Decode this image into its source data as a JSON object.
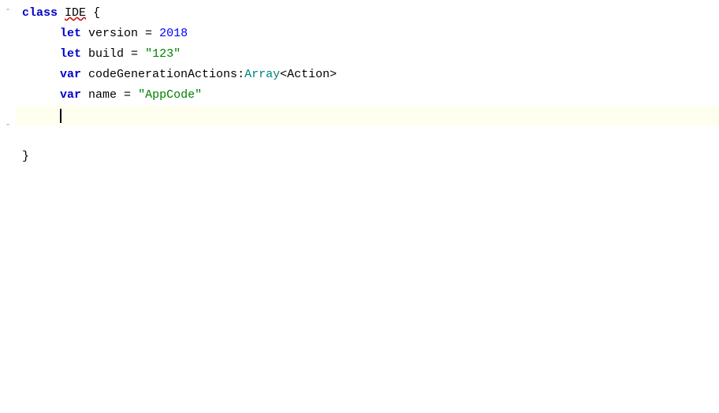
{
  "editor": {
    "background": "#ffffff",
    "highlight_line_bg": "#fffff0",
    "lines": [
      {
        "id": "line1",
        "content": "class_def",
        "highlighted": false
      },
      {
        "id": "line2",
        "content": "let_version",
        "highlighted": false
      },
      {
        "id": "line3",
        "content": "let_build",
        "highlighted": false
      },
      {
        "id": "line4",
        "content": "var_code",
        "highlighted": false
      },
      {
        "id": "line5",
        "content": "var_name",
        "highlighted": false
      },
      {
        "id": "line6",
        "content": "cursor_line",
        "highlighted": true
      },
      {
        "id": "line7",
        "content": "empty",
        "highlighted": false
      },
      {
        "id": "line8",
        "content": "close_brace",
        "highlighted": false
      }
    ],
    "tokens": {
      "keyword_let": "let",
      "keyword_var": "var",
      "keyword_class": "class",
      "class_name": "IDE",
      "open_brace": "{",
      "close_brace": "}",
      "version_key": "version",
      "version_val": "2018",
      "build_key": "build",
      "build_val": "\"123\"",
      "code_gen_key": "codeGenerationActions",
      "code_gen_type": "Array",
      "code_gen_type2": "Action",
      "name_key": "name",
      "name_val": "\"AppCode\""
    }
  }
}
